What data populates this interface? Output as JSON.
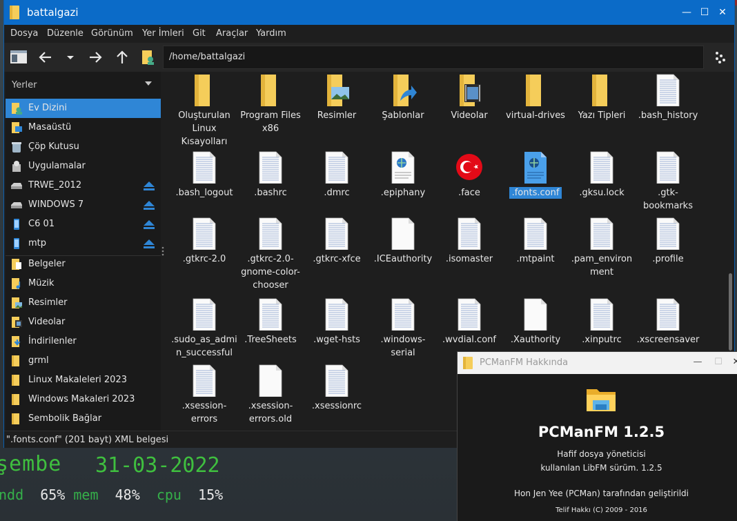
{
  "window": {
    "title": "battalgazi"
  },
  "menu": [
    "Dosya",
    "Düzenle",
    "Görünüm",
    "Yer İmleri",
    "Git",
    "Araçlar",
    "Yardım"
  ],
  "address": "/home/battalgazi",
  "sidebar": {
    "header": "Yerler",
    "places": [
      {
        "label": "Ev Dizini",
        "icon": "home-folder-icon",
        "selected": true
      },
      {
        "label": "Masaüstü",
        "icon": "desktop-folder-icon"
      },
      {
        "label": "Çöp Kutusu",
        "icon": "trash-icon"
      },
      {
        "label": "Uygulamalar",
        "icon": "applications-icon"
      },
      {
        "label": "TRWE_2012",
        "icon": "drive-icon",
        "eject": true
      },
      {
        "label": "WINDOWS 7",
        "icon": "drive-icon",
        "eject": true
      },
      {
        "label": "C6 01",
        "icon": "phone-icon",
        "eject": true
      },
      {
        "label": "mtp",
        "icon": "phone-icon",
        "eject": true
      }
    ],
    "bookmarks": [
      {
        "label": "Belgeler",
        "icon": "documents-folder-icon"
      },
      {
        "label": "Müzik",
        "icon": "music-folder-icon"
      },
      {
        "label": "Resimler",
        "icon": "pictures-folder-icon"
      },
      {
        "label": "Videolar",
        "icon": "videos-folder-icon"
      },
      {
        "label": "İndirilenler",
        "icon": "downloads-folder-icon"
      },
      {
        "label": "grml",
        "icon": "folder-icon"
      },
      {
        "label": "Linux Makaleleri 2023",
        "icon": "folder-icon"
      },
      {
        "label": "Windows Makaleri 2023",
        "icon": "folder-icon"
      },
      {
        "label": "Sembolik Bağlar",
        "icon": "folder-icon"
      }
    ]
  },
  "files": [
    {
      "name": "Oluşturulan Linux Kısayolları",
      "type": "folder"
    },
    {
      "name": "Program Files x86",
      "type": "folder"
    },
    {
      "name": "Resimler",
      "type": "folder-pictures"
    },
    {
      "name": "Şablonlar",
      "type": "folder-templates"
    },
    {
      "name": "Videolar",
      "type": "folder-videos"
    },
    {
      "name": "virtual-drives",
      "type": "folder"
    },
    {
      "name": "Yazı Tipleri",
      "type": "folder"
    },
    {
      "name": ".bash_history",
      "type": "text"
    },
    {
      "name": ".bash_logout",
      "type": "text"
    },
    {
      "name": ".bashrc",
      "type": "text"
    },
    {
      "name": ".dmrc",
      "type": "text"
    },
    {
      "name": ".epiphany",
      "type": "xml"
    },
    {
      "name": ".face",
      "type": "flag"
    },
    {
      "name": ".fonts.conf",
      "type": "xml-selected",
      "selected": true
    },
    {
      "name": ".gksu.lock",
      "type": "text"
    },
    {
      "name": ".gtk-bookmarks",
      "type": "text"
    },
    {
      "name": ".gtkrc-2.0",
      "type": "text"
    },
    {
      "name": ".gtkrc-2.0-gnome-color-chooser",
      "type": "text"
    },
    {
      "name": ".gtkrc-xfce",
      "type": "text"
    },
    {
      "name": ".ICEauthority",
      "type": "blank"
    },
    {
      "name": ".isomaster",
      "type": "text"
    },
    {
      "name": ".mtpaint",
      "type": "text"
    },
    {
      "name": ".pam_environment",
      "type": "text"
    },
    {
      "name": ".profile",
      "type": "text"
    },
    {
      "name": ".sudo_as_admin_successful",
      "type": "text"
    },
    {
      "name": ".TreeSheets",
      "type": "text"
    },
    {
      "name": ".wget-hsts",
      "type": "text"
    },
    {
      "name": ".windows-serial",
      "type": "text"
    },
    {
      "name": ".wvdial.conf",
      "type": "text"
    },
    {
      "name": ".Xauthority",
      "type": "blank"
    },
    {
      "name": ".xinputrc",
      "type": "text"
    },
    {
      "name": ".xscreensaver",
      "type": "text"
    },
    {
      "name": ".xsession-errors",
      "type": "text"
    },
    {
      "name": ".xsession-errors.old",
      "type": "blank"
    },
    {
      "name": ".xsessionrc",
      "type": "text"
    }
  ],
  "status": "\".fonts.conf\" (201 bayt) XML belgesi",
  "about": {
    "title": "PCManFM Hakkında",
    "name": "PCManFM 1.2.5",
    "desc1": "Hafif dosya yöneticisi",
    "desc2": "kullanılan LibFM sürüm. 1.2.5",
    "author": "Hon Jen Yee (PCMan) tarafından geliştirildi",
    "copyright": "Telif Hakkı (C) 2009 - 2016"
  },
  "conky": {
    "day": "şembe",
    "date": "31-03-2022",
    "hdd_label": "ndd",
    "hdd_value": "65%",
    "mem_label": "mem",
    "mem_value": "48%",
    "cpu_label": "cpu",
    "cpu_value": "15%"
  },
  "colors": {
    "accent": "#2f86d6",
    "titlebar": "#0b6bc8",
    "folder": "#f5cd5a",
    "conky_green": "#3fbf3f"
  }
}
